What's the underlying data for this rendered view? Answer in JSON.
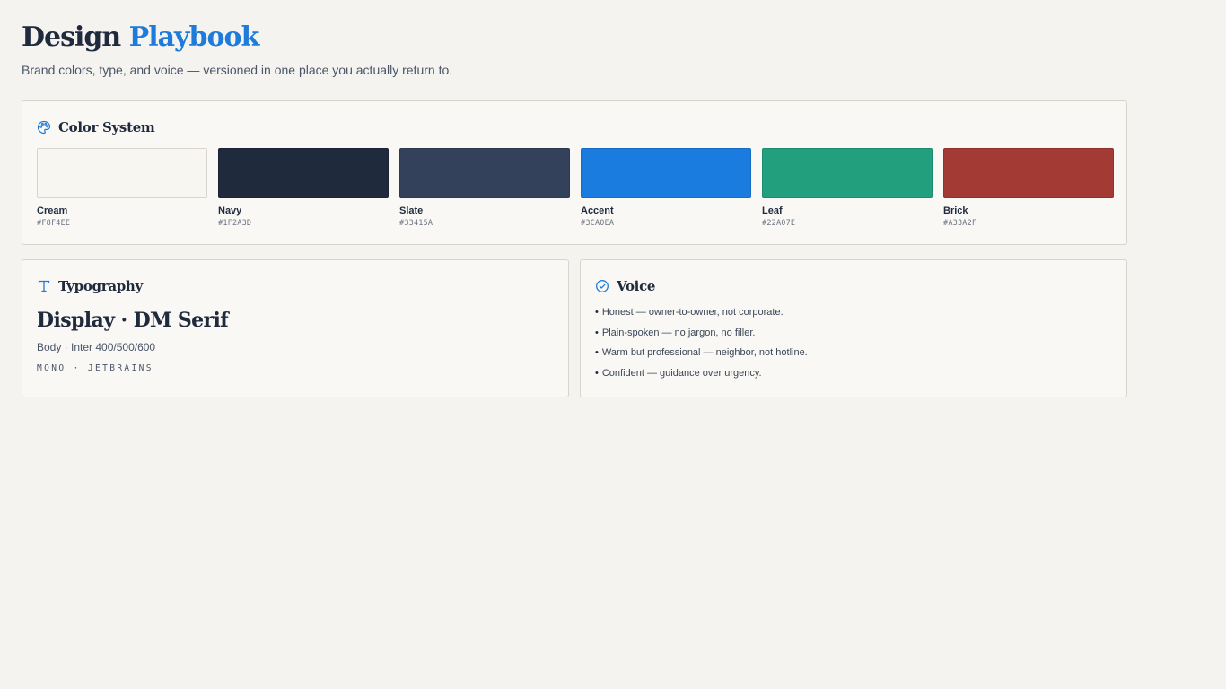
{
  "header": {
    "title_part1": "Design",
    "title_part2": "Playbook",
    "subtitle": "Brand colors, type, and voice — versioned in one place you actually return to."
  },
  "colors_section": {
    "title": "Color System",
    "icon": "palette-icon",
    "swatches": [
      {
        "name": "Cream",
        "hex": "#F8F4EE",
        "color": "#F8F6F1"
      },
      {
        "name": "Navy",
        "hex": "#1F2A3D",
        "color": "#1F2A3D"
      },
      {
        "name": "Slate",
        "hex": "#33415A",
        "color": "#33415A"
      },
      {
        "name": "Accent",
        "hex": "#3CA0EA",
        "color": "#1B7CE0"
      },
      {
        "name": "Leaf",
        "hex": "#22A07E",
        "color": "#22A07E"
      },
      {
        "name": "Brick",
        "hex": "#A33A2F",
        "color": "#A33A33"
      }
    ]
  },
  "typography_section": {
    "title": "Typography",
    "icon": "type-icon",
    "display": "Display · DM Serif",
    "body": "Body · Inter 400/500/600",
    "mono": "MONO · JETBRAINS"
  },
  "voice_section": {
    "title": "Voice",
    "icon": "check-circle-icon",
    "items": [
      "Honest — owner-to-owner, not corporate.",
      "Plain-spoken — no jargon, no filler.",
      "Warm but professional — neighbor, not hotline.",
      "Confident — guidance over urgency."
    ]
  },
  "theme": {
    "background": "#F5F3EF",
    "accent": "#1E7BD9",
    "text": "#1F2A3D"
  }
}
